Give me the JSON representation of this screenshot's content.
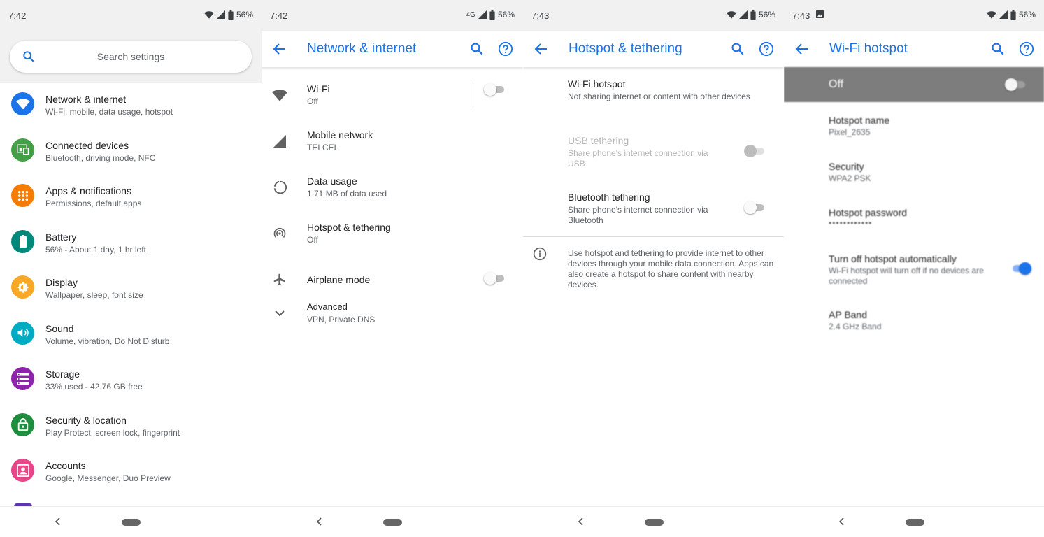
{
  "colors": {
    "accent": "#1a73e8",
    "network": "#1a73e8",
    "connected": "#43a047",
    "apps": "#f57c00",
    "battery": "#00897b",
    "display": "#f9a825",
    "sound": "#00acc1",
    "storage": "#8e24aa",
    "security": "#1e8e3e",
    "accounts": "#e8458b"
  },
  "screen1": {
    "status": {
      "time": "7:42",
      "battery": "56%"
    },
    "search_placeholder": "Search settings",
    "items": [
      {
        "title": "Network & internet",
        "sub": "Wi-Fi, mobile, data usage, hotspot",
        "icon": "wifi-icon"
      },
      {
        "title": "Connected devices",
        "sub": "Bluetooth, driving mode, NFC",
        "icon": "devices-icon"
      },
      {
        "title": "Apps & notifications",
        "sub": "Permissions, default apps",
        "icon": "apps-grid-icon"
      },
      {
        "title": "Battery",
        "sub": "56% - About 1 day, 1 hr left",
        "icon": "battery-icon"
      },
      {
        "title": "Display",
        "sub": "Wallpaper, sleep, font size",
        "icon": "brightness-icon"
      },
      {
        "title": "Sound",
        "sub": "Volume, vibration, Do Not Disturb",
        "icon": "volume-icon"
      },
      {
        "title": "Storage",
        "sub": "33% used - 42.76 GB free",
        "icon": "storage-icon"
      },
      {
        "title": "Security & location",
        "sub": "Play Protect, screen lock, fingerprint",
        "icon": "lock-icon"
      },
      {
        "title": "Accounts",
        "sub": "Google, Messenger, Duo Preview",
        "icon": "account-icon"
      }
    ]
  },
  "screen2": {
    "status": {
      "time": "7:42",
      "network": "4G",
      "battery": "56%"
    },
    "title": "Network & internet",
    "items": [
      {
        "title": "Wi-Fi",
        "sub": "Off",
        "icon": "wifi-icon",
        "toggle": "off"
      },
      {
        "title": "Mobile network",
        "sub": "TELCEL",
        "icon": "signal-icon"
      },
      {
        "title": "Data usage",
        "sub": "1.71 MB of data used",
        "icon": "data-usage-icon"
      },
      {
        "title": "Hotspot & tethering",
        "sub": "Off",
        "icon": "hotspot-icon"
      },
      {
        "title": "Airplane mode",
        "sub": "",
        "icon": "airplane-icon",
        "toggle": "off"
      },
      {
        "title": "Advanced",
        "sub": "VPN, Private DNS",
        "icon": "chevron-down-icon"
      }
    ]
  },
  "screen3": {
    "status": {
      "time": "7:43",
      "battery": "56%"
    },
    "title": "Hotspot & tethering",
    "items": [
      {
        "title": "Wi-Fi hotspot",
        "sub": "Not sharing internet or content with other devices"
      },
      {
        "title": "USB tethering",
        "sub": "Share phone's internet connection via USB",
        "disabled": true,
        "toggle": "off"
      },
      {
        "title": "Bluetooth tethering",
        "sub": "Share phone's internet connection via Bluetooth",
        "toggle": "off"
      }
    ],
    "info": "Use hotspot and tethering to provide internet to other devices through your mobile data connection. Apps can also create a hotspot to share content with nearby devices."
  },
  "screen4": {
    "status": {
      "time": "7:43",
      "battery": "56%"
    },
    "title": "Wi-Fi hotspot",
    "master_label": "Off",
    "items": [
      {
        "title": "Hotspot name",
        "sub": "Pixel_2635"
      },
      {
        "title": "Security",
        "sub": "WPA2 PSK"
      },
      {
        "title": "Hotspot password",
        "sub": "••••••••••••"
      },
      {
        "title": "Turn off hotspot automatically",
        "sub": "Wi-Fi hotspot will turn off if no devices are connected",
        "toggle": "on"
      },
      {
        "title": "AP Band",
        "sub": "2.4 GHz Band"
      }
    ]
  }
}
